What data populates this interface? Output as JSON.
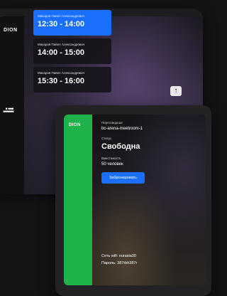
{
  "back_screen": {
    "logo": "DION",
    "slots": [
      {
        "person": "Макаров Павел Александрович",
        "time": "12:30 - 14:00",
        "active": true
      },
      {
        "person": "Макаров Павел Александрович",
        "time": "14:00 - 15:00",
        "active": false
      },
      {
        "person": "Макаров Павел Александрович",
        "time": "15:30 - 16:00",
        "active": false
      }
    ],
    "scroll_up_glyph": "↑"
  },
  "front_screen": {
    "logo": "DION",
    "room_label": "Переговорная",
    "room_name": "bc-arena-meetroom-1",
    "status_label": "Статус",
    "status_value": "Свободна",
    "capacity_label": "Вместимость",
    "capacity_value": "50 человек",
    "book_button": "Забронировать",
    "wifi_network": "Сеть wifi: eurasia30",
    "wifi_password": "Пароль: 387rbh387r"
  },
  "colors": {
    "accent_blue": "#1a6fff",
    "brand_green": "#1fb24a"
  }
}
